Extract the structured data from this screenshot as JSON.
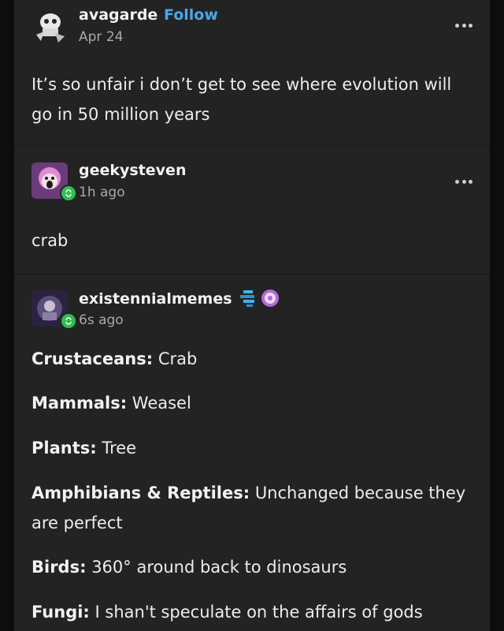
{
  "posts": [
    {
      "username": "avagarde",
      "follow_label": "Follow",
      "date": "Apr 24",
      "avatar_icon": "skull-sketch-avatar-icon",
      "text": "It’s so unfair i don’t get to see where evolution will go in 50 million years"
    },
    {
      "username": "geekysteven",
      "date": "1h ago",
      "avatar_icon": "pink-hair-cartoon-avatar-icon",
      "text": "crab"
    },
    {
      "username": "existennialmemes",
      "date": "6s ago",
      "avatar_icon": "dark-portrait-avatar-icon",
      "badges": [
        "blue-pixel-badge-icon",
        "purple-flower-badge-icon"
      ],
      "items": [
        {
          "label": "Crustaceans:",
          "value": "Crab"
        },
        {
          "label": "Mammals:",
          "value": "Weasel"
        },
        {
          "label": "Plants:",
          "value": "Tree"
        },
        {
          "label": "Amphibians & Reptiles:",
          "value": "Unchanged because they are perfect"
        },
        {
          "label": "Birds:",
          "value": "360° around back to dinosaurs"
        },
        {
          "label": "Fungi:",
          "value": "I shan't speculate on the affairs of gods"
        }
      ]
    }
  ],
  "colors": {
    "background": "#0d0d0d",
    "card": "#232323",
    "follow": "#4aa8e8",
    "reblog_badge": "#2fbf4a"
  }
}
